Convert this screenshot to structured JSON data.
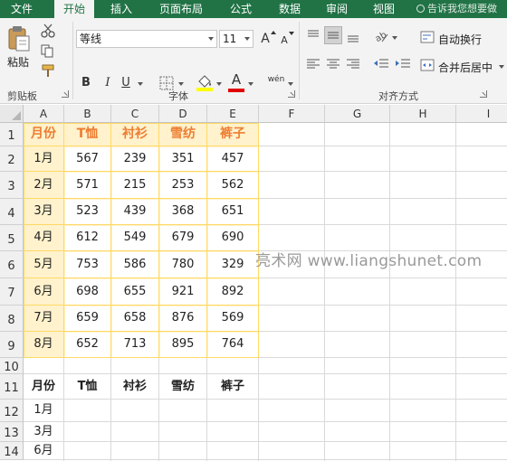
{
  "ribbon": {
    "tabs": [
      "文件",
      "开始",
      "插入",
      "页面布局",
      "公式",
      "数据",
      "审阅",
      "视图"
    ],
    "active_tab": "开始",
    "tell_me": "告诉我您想要做",
    "clipboard": {
      "paste_label": "粘贴",
      "group_label": "剪贴板"
    },
    "font": {
      "name": "等线",
      "size": "11",
      "group_label": "字体",
      "bold": "B",
      "italic": "I",
      "underline": "U",
      "increase": "A",
      "decrease": "A",
      "font_color_letter": "A",
      "phonetic": "wén"
    },
    "alignment": {
      "wrap_text": "自动换行",
      "merge_center": "合并后居中",
      "group_label": "对齐方式"
    }
  },
  "sheet": {
    "columns": [
      "A",
      "B",
      "C",
      "D",
      "E",
      "F",
      "G",
      "H",
      "I"
    ],
    "rows": [
      "1",
      "2",
      "3",
      "4",
      "5",
      "6",
      "7",
      "8",
      "9",
      "10",
      "11",
      "12",
      "13",
      "14"
    ],
    "table": {
      "headers": [
        "月份",
        "T恤",
        "衬衫",
        "雪纺",
        "裤子"
      ],
      "data": [
        [
          "1月",
          "567",
          "239",
          "351",
          "457"
        ],
        [
          "2月",
          "571",
          "215",
          "253",
          "562"
        ],
        [
          "3月",
          "523",
          "439",
          "368",
          "651"
        ],
        [
          "4月",
          "612",
          "549",
          "679",
          "690"
        ],
        [
          "5月",
          "753",
          "586",
          "780",
          "329"
        ],
        [
          "6月",
          "698",
          "655",
          "921",
          "892"
        ],
        [
          "7月",
          "659",
          "658",
          "876",
          "569"
        ],
        [
          "8月",
          "652",
          "713",
          "895",
          "764"
        ]
      ]
    },
    "lookup": {
      "headers": [
        "月份",
        "T恤",
        "衬衫",
        "雪纺",
        "裤子"
      ],
      "months": [
        "1月",
        "3月",
        "6月"
      ]
    }
  },
  "watermark": "亮术网 www.liangshunet.com",
  "colors": {
    "ribbon_green": "#217346",
    "header_orange": "#ed7d31",
    "table_fill": "#fff2cc",
    "table_border": "#ffd966",
    "font_color_bar": "#e00000",
    "highlight_bar": "#ffff00"
  }
}
